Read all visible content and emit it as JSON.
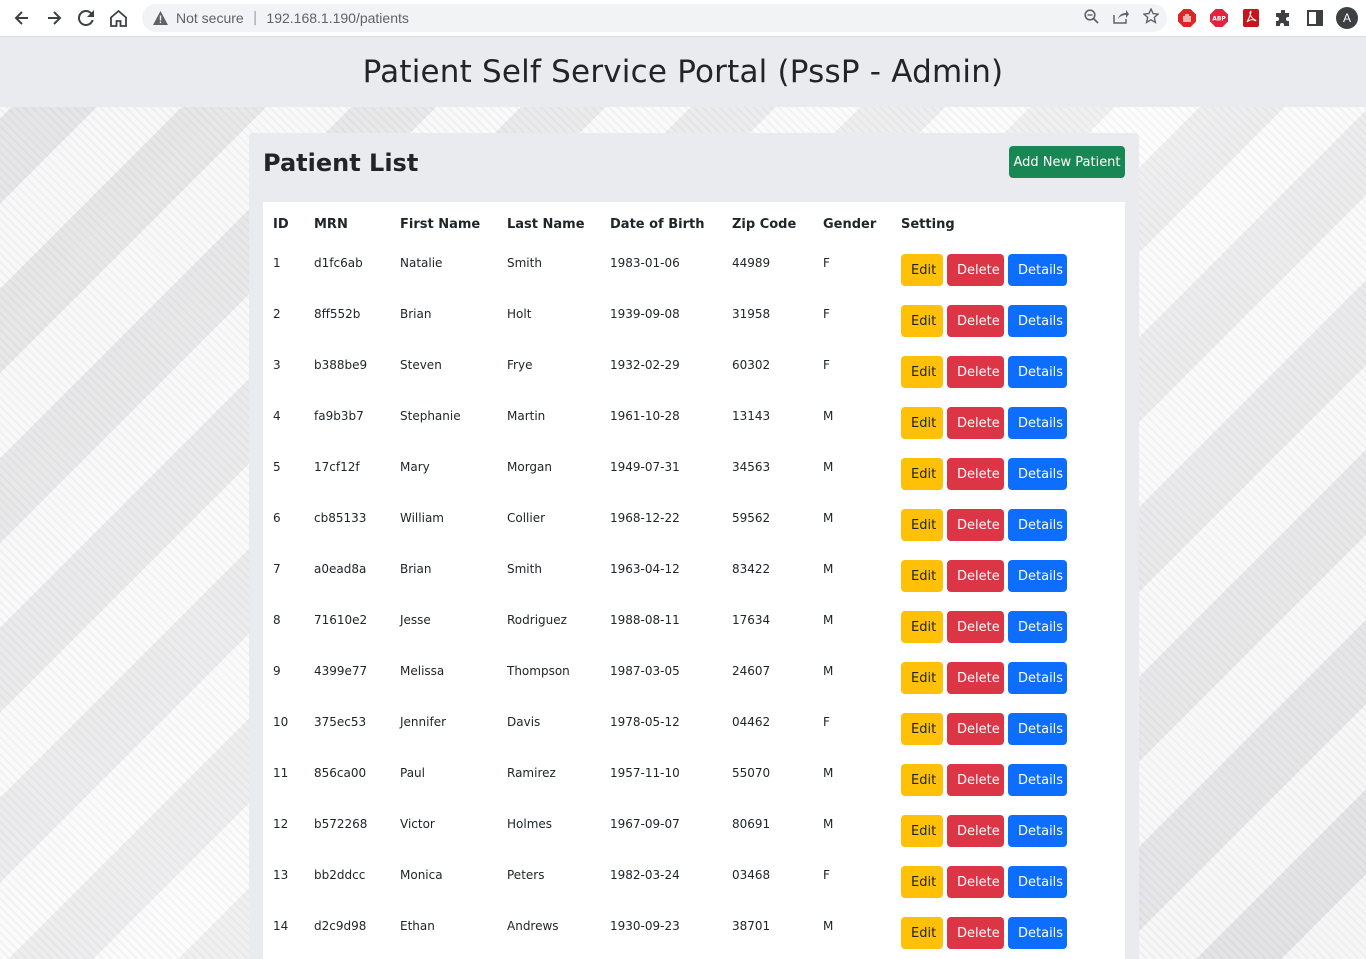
{
  "browser": {
    "not_secure": "Not secure",
    "url": "192.168.1.190/patients",
    "avatar_letter": "A"
  },
  "header": {
    "title": "Patient Self Service Portal (PssP - Admin)"
  },
  "card": {
    "title": "Patient List",
    "add_button": "Add New Patient"
  },
  "table": {
    "columns": [
      "ID",
      "MRN",
      "First Name",
      "Last Name",
      "Date of Birth",
      "Zip Code",
      "Gender",
      "Setting"
    ],
    "actions": {
      "edit": "Edit",
      "delete": "Delete",
      "details": "Details"
    },
    "rows": [
      [
        "1",
        "d1fc6ab",
        "Natalie",
        "Smith",
        "1983-01-06",
        "44989",
        "F"
      ],
      [
        "2",
        "8ff552b",
        "Brian",
        "Holt",
        "1939-09-08",
        "31958",
        "F"
      ],
      [
        "3",
        "b388be9",
        "Steven",
        "Frye",
        "1932-02-29",
        "60302",
        "F"
      ],
      [
        "4",
        "fa9b3b7",
        "Stephanie",
        "Martin",
        "1961-10-28",
        "13143",
        "M"
      ],
      [
        "5",
        "17cf12f",
        "Mary",
        "Morgan",
        "1949-07-31",
        "34563",
        "M"
      ],
      [
        "6",
        "cb85133",
        "William",
        "Collier",
        "1968-12-22",
        "59562",
        "M"
      ],
      [
        "7",
        "a0ead8a",
        "Brian",
        "Smith",
        "1963-04-12",
        "83422",
        "M"
      ],
      [
        "8",
        "71610e2",
        "Jesse",
        "Rodriguez",
        "1988-08-11",
        "17634",
        "M"
      ],
      [
        "9",
        "4399e77",
        "Melissa",
        "Thompson",
        "1987-03-05",
        "24607",
        "M"
      ],
      [
        "10",
        "375ec53",
        "Jennifer",
        "Davis",
        "1978-05-12",
        "04462",
        "F"
      ],
      [
        "11",
        "856ca00",
        "Paul",
        "Ramirez",
        "1957-11-10",
        "55070",
        "M"
      ],
      [
        "12",
        "b572268",
        "Victor",
        "Holmes",
        "1967-09-07",
        "80691",
        "M"
      ],
      [
        "13",
        "bb2ddcc",
        "Monica",
        "Peters",
        "1982-03-24",
        "03468",
        "F"
      ],
      [
        "14",
        "d2c9d98",
        "Ethan",
        "Andrews",
        "1930-09-23",
        "38701",
        "M"
      ]
    ]
  },
  "colors": {
    "success": "#198754",
    "warning": "#ffc107",
    "danger": "#dc3545",
    "primary": "#0d6efd"
  }
}
